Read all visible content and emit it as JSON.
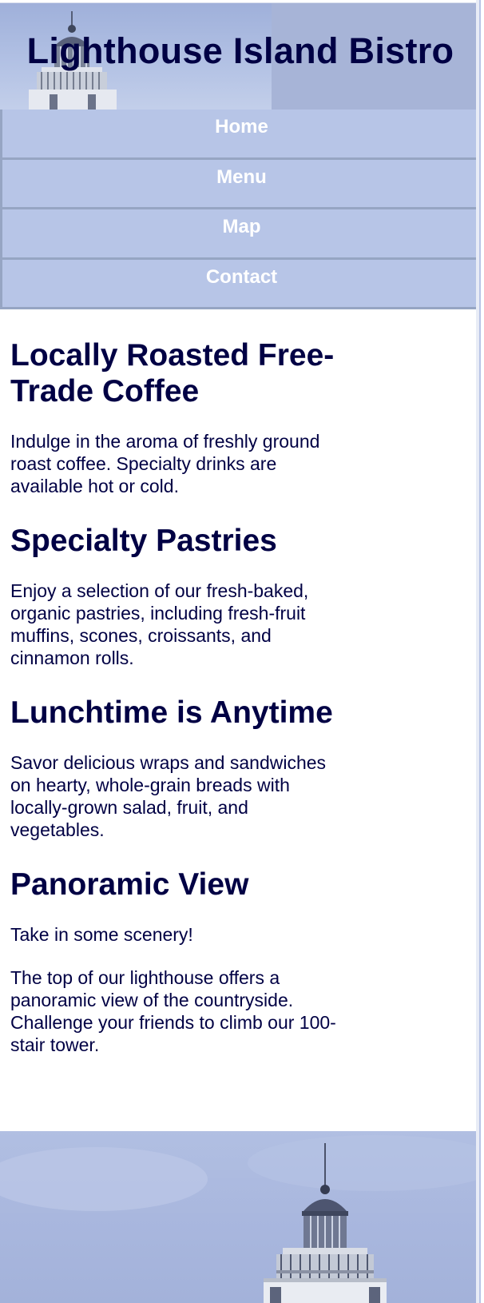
{
  "header": {
    "title": "Lighthouse Island Bistro"
  },
  "nav": {
    "items": [
      {
        "label": "Home"
      },
      {
        "label": "Menu"
      },
      {
        "label": "Map"
      },
      {
        "label": "Contact"
      }
    ]
  },
  "main": {
    "sections": [
      {
        "heading": "Locally Roasted Free-Trade Coffee",
        "paragraphs": [
          "Indulge in the aroma of freshly ground roast coffee. Specialty drinks are available hot or cold."
        ]
      },
      {
        "heading": "Specialty Pastries",
        "paragraphs": [
          "Enjoy a selection of our fresh-baked, organic pastries, including fresh-fruit muffins, scones, croissants, and cinnamon rolls."
        ]
      },
      {
        "heading": "Lunchtime is Anytime",
        "paragraphs": [
          "Savor delicious wraps and sandwiches on hearty, whole-grain breads with locally-grown salad, fruit, and vegetables."
        ]
      },
      {
        "heading": "Panoramic View",
        "paragraphs": [
          "Take in some scenery!",
          "The top of our lighthouse offers a panoramic view of the countryside. Challenge your friends to climb our 100-stair tower."
        ]
      }
    ]
  },
  "colors": {
    "heading": "#000044",
    "nav_background": "#b7c5e7",
    "nav_text": "#ffffff",
    "header_background": "#a6b3d6"
  }
}
